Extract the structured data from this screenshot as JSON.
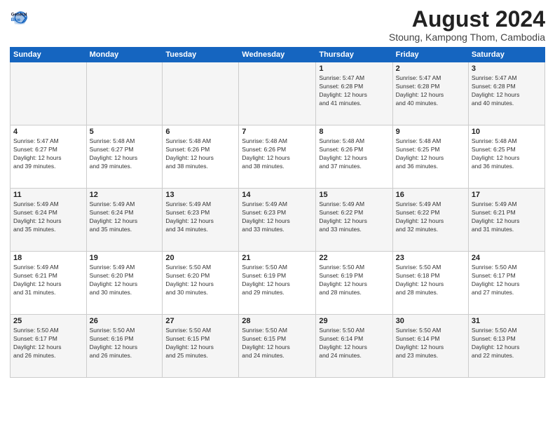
{
  "header": {
    "logo_line1": "General",
    "logo_line2": "Blue",
    "title": "August 2024",
    "subtitle": "Stoung, Kampong Thom, Cambodia"
  },
  "weekdays": [
    "Sunday",
    "Monday",
    "Tuesday",
    "Wednesday",
    "Thursday",
    "Friday",
    "Saturday"
  ],
  "weeks": [
    [
      {
        "day": "",
        "info": ""
      },
      {
        "day": "",
        "info": ""
      },
      {
        "day": "",
        "info": ""
      },
      {
        "day": "",
        "info": ""
      },
      {
        "day": "1",
        "info": "Sunrise: 5:47 AM\nSunset: 6:28 PM\nDaylight: 12 hours\nand 41 minutes."
      },
      {
        "day": "2",
        "info": "Sunrise: 5:47 AM\nSunset: 6:28 PM\nDaylight: 12 hours\nand 40 minutes."
      },
      {
        "day": "3",
        "info": "Sunrise: 5:47 AM\nSunset: 6:28 PM\nDaylight: 12 hours\nand 40 minutes."
      }
    ],
    [
      {
        "day": "4",
        "info": "Sunrise: 5:47 AM\nSunset: 6:27 PM\nDaylight: 12 hours\nand 39 minutes."
      },
      {
        "day": "5",
        "info": "Sunrise: 5:48 AM\nSunset: 6:27 PM\nDaylight: 12 hours\nand 39 minutes."
      },
      {
        "day": "6",
        "info": "Sunrise: 5:48 AM\nSunset: 6:26 PM\nDaylight: 12 hours\nand 38 minutes."
      },
      {
        "day": "7",
        "info": "Sunrise: 5:48 AM\nSunset: 6:26 PM\nDaylight: 12 hours\nand 38 minutes."
      },
      {
        "day": "8",
        "info": "Sunrise: 5:48 AM\nSunset: 6:26 PM\nDaylight: 12 hours\nand 37 minutes."
      },
      {
        "day": "9",
        "info": "Sunrise: 5:48 AM\nSunset: 6:25 PM\nDaylight: 12 hours\nand 36 minutes."
      },
      {
        "day": "10",
        "info": "Sunrise: 5:48 AM\nSunset: 6:25 PM\nDaylight: 12 hours\nand 36 minutes."
      }
    ],
    [
      {
        "day": "11",
        "info": "Sunrise: 5:49 AM\nSunset: 6:24 PM\nDaylight: 12 hours\nand 35 minutes."
      },
      {
        "day": "12",
        "info": "Sunrise: 5:49 AM\nSunset: 6:24 PM\nDaylight: 12 hours\nand 35 minutes."
      },
      {
        "day": "13",
        "info": "Sunrise: 5:49 AM\nSunset: 6:23 PM\nDaylight: 12 hours\nand 34 minutes."
      },
      {
        "day": "14",
        "info": "Sunrise: 5:49 AM\nSunset: 6:23 PM\nDaylight: 12 hours\nand 33 minutes."
      },
      {
        "day": "15",
        "info": "Sunrise: 5:49 AM\nSunset: 6:22 PM\nDaylight: 12 hours\nand 33 minutes."
      },
      {
        "day": "16",
        "info": "Sunrise: 5:49 AM\nSunset: 6:22 PM\nDaylight: 12 hours\nand 32 minutes."
      },
      {
        "day": "17",
        "info": "Sunrise: 5:49 AM\nSunset: 6:21 PM\nDaylight: 12 hours\nand 31 minutes."
      }
    ],
    [
      {
        "day": "18",
        "info": "Sunrise: 5:49 AM\nSunset: 6:21 PM\nDaylight: 12 hours\nand 31 minutes."
      },
      {
        "day": "19",
        "info": "Sunrise: 5:49 AM\nSunset: 6:20 PM\nDaylight: 12 hours\nand 30 minutes."
      },
      {
        "day": "20",
        "info": "Sunrise: 5:50 AM\nSunset: 6:20 PM\nDaylight: 12 hours\nand 30 minutes."
      },
      {
        "day": "21",
        "info": "Sunrise: 5:50 AM\nSunset: 6:19 PM\nDaylight: 12 hours\nand 29 minutes."
      },
      {
        "day": "22",
        "info": "Sunrise: 5:50 AM\nSunset: 6:19 PM\nDaylight: 12 hours\nand 28 minutes."
      },
      {
        "day": "23",
        "info": "Sunrise: 5:50 AM\nSunset: 6:18 PM\nDaylight: 12 hours\nand 28 minutes."
      },
      {
        "day": "24",
        "info": "Sunrise: 5:50 AM\nSunset: 6:17 PM\nDaylight: 12 hours\nand 27 minutes."
      }
    ],
    [
      {
        "day": "25",
        "info": "Sunrise: 5:50 AM\nSunset: 6:17 PM\nDaylight: 12 hours\nand 26 minutes."
      },
      {
        "day": "26",
        "info": "Sunrise: 5:50 AM\nSunset: 6:16 PM\nDaylight: 12 hours\nand 26 minutes."
      },
      {
        "day": "27",
        "info": "Sunrise: 5:50 AM\nSunset: 6:15 PM\nDaylight: 12 hours\nand 25 minutes."
      },
      {
        "day": "28",
        "info": "Sunrise: 5:50 AM\nSunset: 6:15 PM\nDaylight: 12 hours\nand 24 minutes."
      },
      {
        "day": "29",
        "info": "Sunrise: 5:50 AM\nSunset: 6:14 PM\nDaylight: 12 hours\nand 24 minutes."
      },
      {
        "day": "30",
        "info": "Sunrise: 5:50 AM\nSunset: 6:14 PM\nDaylight: 12 hours\nand 23 minutes."
      },
      {
        "day": "31",
        "info": "Sunrise: 5:50 AM\nSunset: 6:13 PM\nDaylight: 12 hours\nand 22 minutes."
      }
    ]
  ]
}
